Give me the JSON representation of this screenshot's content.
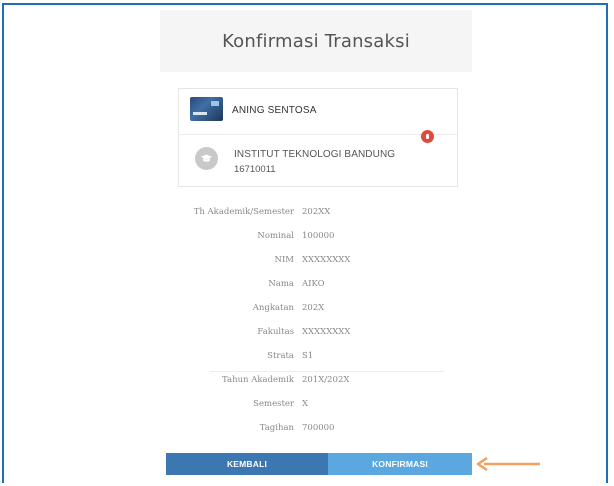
{
  "page": {
    "title": "Konfirmasi Transaksi"
  },
  "account": {
    "name": "ANING SENTOSA"
  },
  "institution": {
    "name": "INSTITUT TEKNOLOGI BANDUNG",
    "code": "16710011"
  },
  "details": [
    {
      "label": "Th Akademik/Semester",
      "value": "202XX"
    },
    {
      "label": "Nominal",
      "value": "100000"
    },
    {
      "label": "NIM",
      "value": "XXXXXXXX"
    },
    {
      "label": "Nama",
      "value": "AIKO"
    },
    {
      "label": "Angkatan",
      "value": "202X"
    },
    {
      "label": "Fakultas",
      "value": "XXXXXXXX"
    },
    {
      "label": "Strata",
      "value": "S1"
    },
    {
      "label": "Tahun Akademik",
      "value": "201X/202X"
    },
    {
      "label": "Semester",
      "value": "X"
    },
    {
      "label": "Tagihan",
      "value": "700000"
    }
  ],
  "buttons": {
    "back": "KEMBALI",
    "confirm": "KONFIRMASI"
  },
  "colors": {
    "frame_border": "#1f6fb8",
    "back_button": "#3c77b2",
    "confirm_button": "#5aa8df",
    "delete_icon": "#e24b3b",
    "arrow": "#f0a062"
  },
  "icons": {
    "delete": "delete-icon",
    "institution": "graduation-cap-icon",
    "arrow": "arrow-left-icon"
  }
}
